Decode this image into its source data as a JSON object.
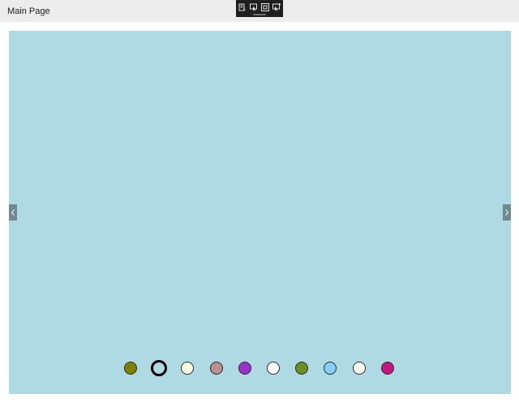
{
  "window": {
    "title": "Main Page"
  },
  "debug_toolbar": {
    "buttons": [
      {
        "name": "live-visual-tree-icon"
      },
      {
        "name": "select-element-icon"
      },
      {
        "name": "display-layout-adorners-icon"
      },
      {
        "name": "track-focused-element-icon"
      }
    ]
  },
  "carousel": {
    "background": "#b0dae3",
    "prev_arrow": "‹",
    "next_arrow": "›",
    "selected_index": 1,
    "indicators": [
      {
        "color": "#808000"
      },
      {
        "color": "#ffffff"
      },
      {
        "color": "#fdfde5"
      },
      {
        "color": "#bc8f8f"
      },
      {
        "color": "#9932cc"
      },
      {
        "color": "#ffffff"
      },
      {
        "color": "#6b8e23"
      },
      {
        "color": "#87cefa"
      },
      {
        "color": "#fffdf8"
      },
      {
        "color": "#c71585"
      }
    ]
  }
}
